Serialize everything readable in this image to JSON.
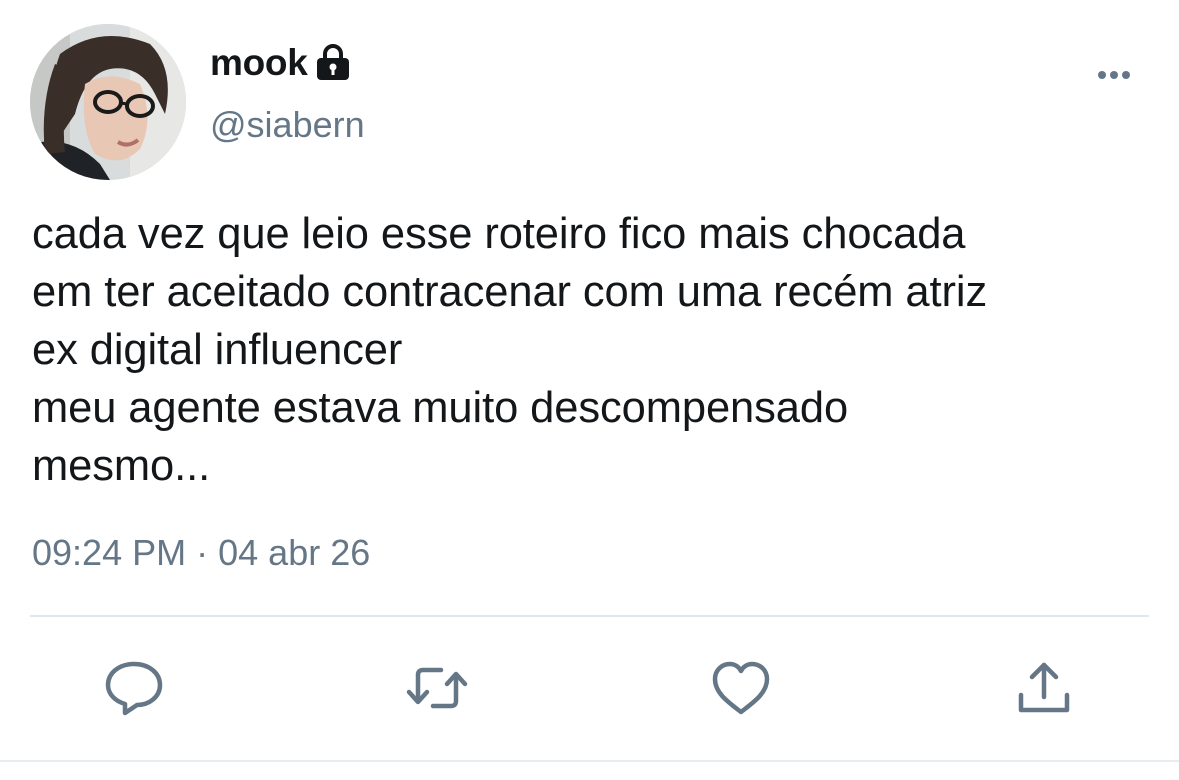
{
  "user": {
    "display_name": "mook",
    "handle": "@siabern",
    "protected_icon": "lock-icon",
    "avatar_icon": "avatar-photo"
  },
  "tweet": {
    "lines": [
      "cada vez que leio esse roteiro fico mais chocada",
      "em ter aceitado contracenar com uma recém atriz",
      "ex digital influencer",
      "meu agente estava muito descompensado",
      "mesmo..."
    ],
    "time": "09:24 PM",
    "separator": "·",
    "date": "04 abr 26"
  },
  "actions": {
    "icons": [
      "reply-icon",
      "retweet-icon",
      "like-icon",
      "share-icon"
    ],
    "more_icon": "more-options-icon"
  },
  "colors": {
    "text": "#14171a",
    "secondary": "#657786",
    "icon": "#657786",
    "divider": "#e1e8ed"
  }
}
